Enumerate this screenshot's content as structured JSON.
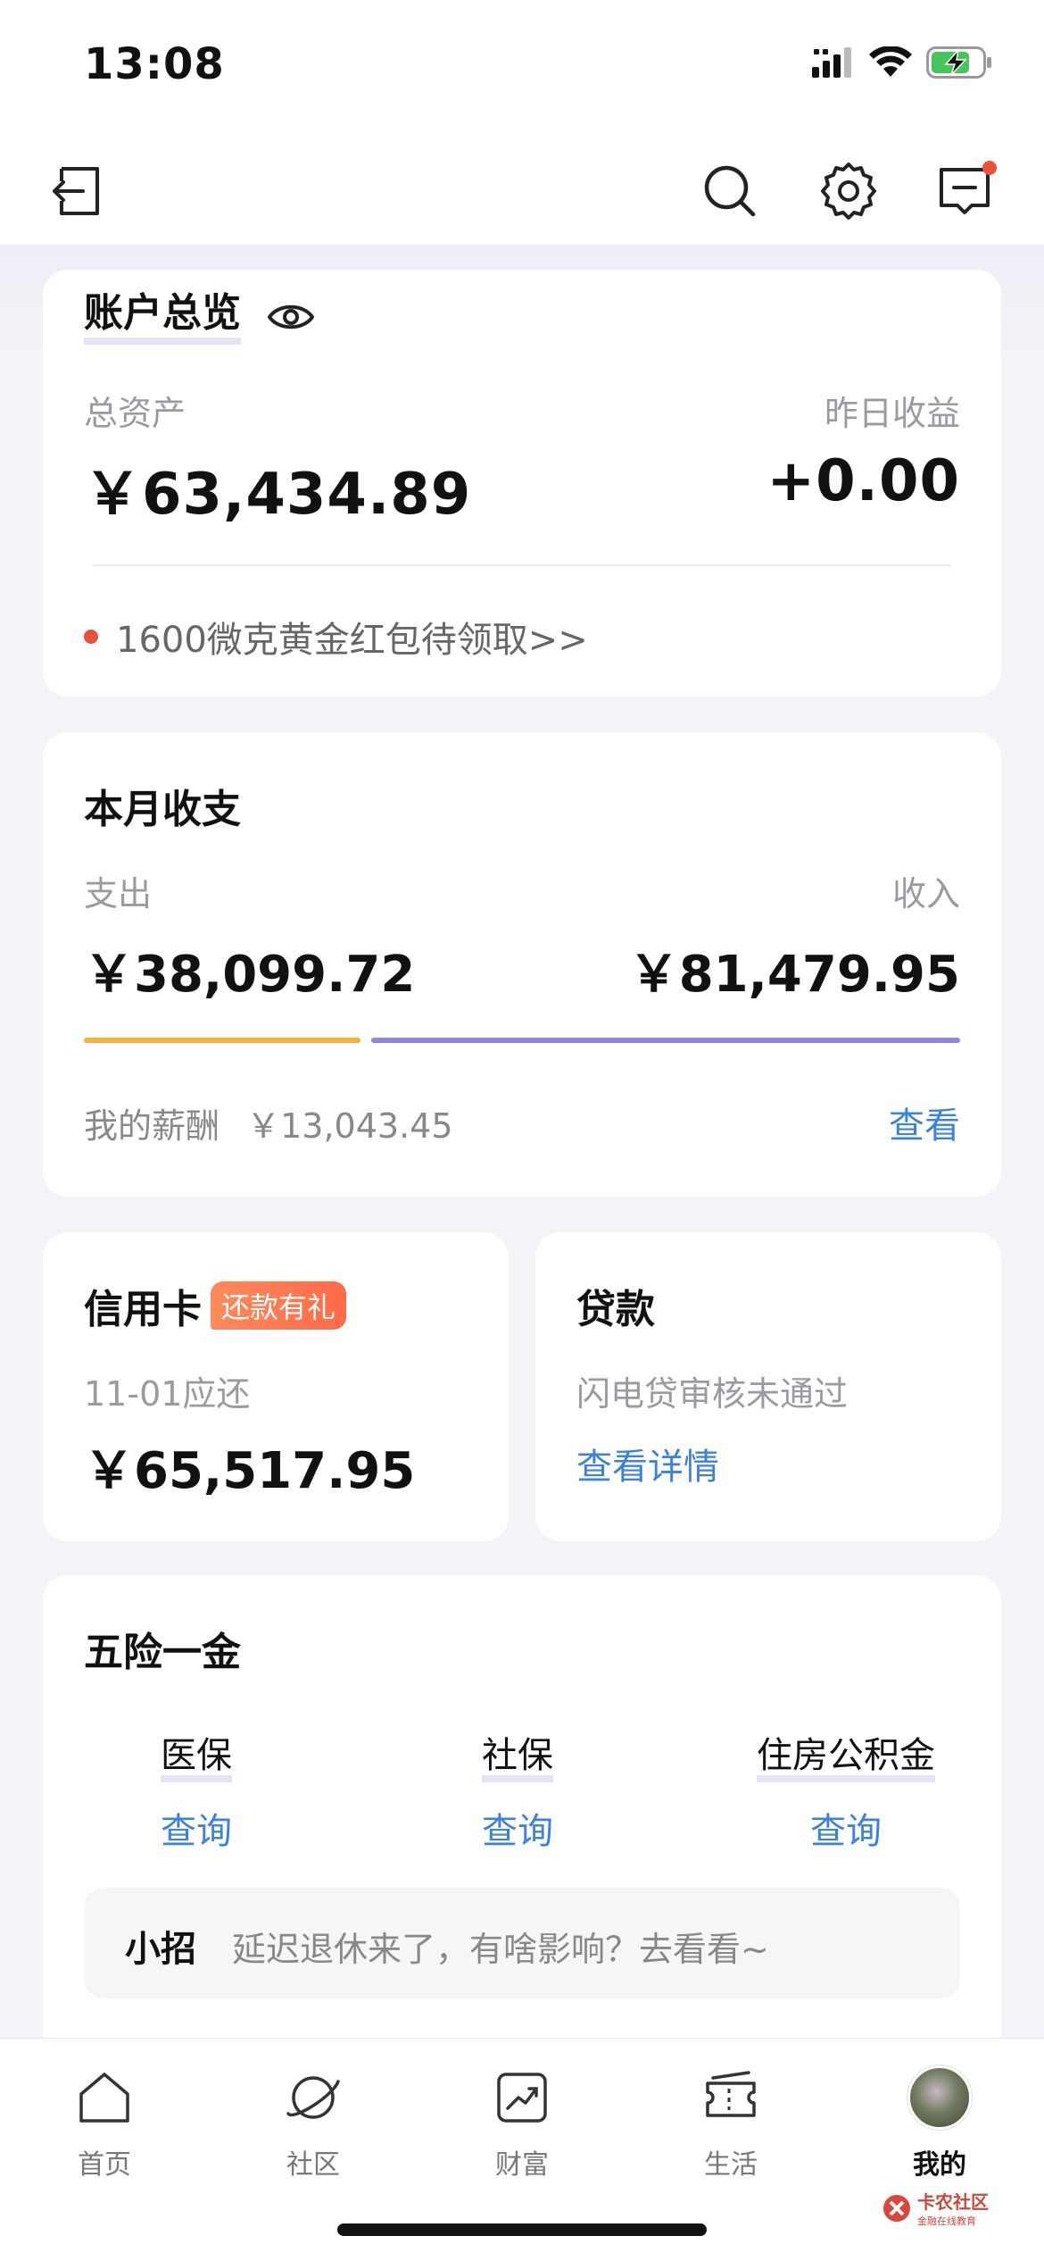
{
  "status_bar": {
    "time": "13:08"
  },
  "account_overview": {
    "title": "账户总览",
    "total_assets_label": "总资产",
    "total_assets_value": "￥63,434.89",
    "yesterday_income_label": "昨日收益",
    "yesterday_income_value": "+0.00",
    "promo_text": "1600微克黄金红包待领取>>"
  },
  "monthly": {
    "title": "本月收支",
    "expense_label": "支出",
    "expense_value": "￥38,099.72",
    "income_label": "收入",
    "income_value": "￥81,479.95",
    "expense_ratio": 0.32,
    "salary_label": "我的薪酬",
    "salary_value": "￥13,043.45",
    "view_label": "查看"
  },
  "credit_card": {
    "title": "信用卡",
    "badge": "还款有礼",
    "due_label": "11-01应还",
    "due_value": "￥65,517.95"
  },
  "loan": {
    "title": "贷款",
    "status": "闪电贷审核未通过",
    "details_link": "查看详情"
  },
  "insurance": {
    "title": "五险一金",
    "items": [
      {
        "label": "医保",
        "action": "查询"
      },
      {
        "label": "社保",
        "action": "查询"
      },
      {
        "label": "住房公积金",
        "action": "查询"
      }
    ],
    "tip_tag": "小招",
    "tip_text": "延迟退休来了，有啥影响？去看看~"
  },
  "tab_bar": {
    "items": [
      {
        "label": "首页",
        "icon": "home-icon"
      },
      {
        "label": "社区",
        "icon": "planet-icon"
      },
      {
        "label": "财富",
        "icon": "chart-icon"
      },
      {
        "label": "生活",
        "icon": "ticket-icon"
      },
      {
        "label": "我的",
        "icon": "avatar"
      }
    ],
    "active_index": 4
  },
  "watermark": {
    "title": "卡农社区",
    "subtitle": "金融在线教育"
  },
  "colors": {
    "accent_blue": "#3c82d9",
    "expense_bar": "#f5b13d",
    "income_bar": "#8f86e0",
    "red_dot": "#e8513a",
    "badge_orange": "#ff7650"
  }
}
